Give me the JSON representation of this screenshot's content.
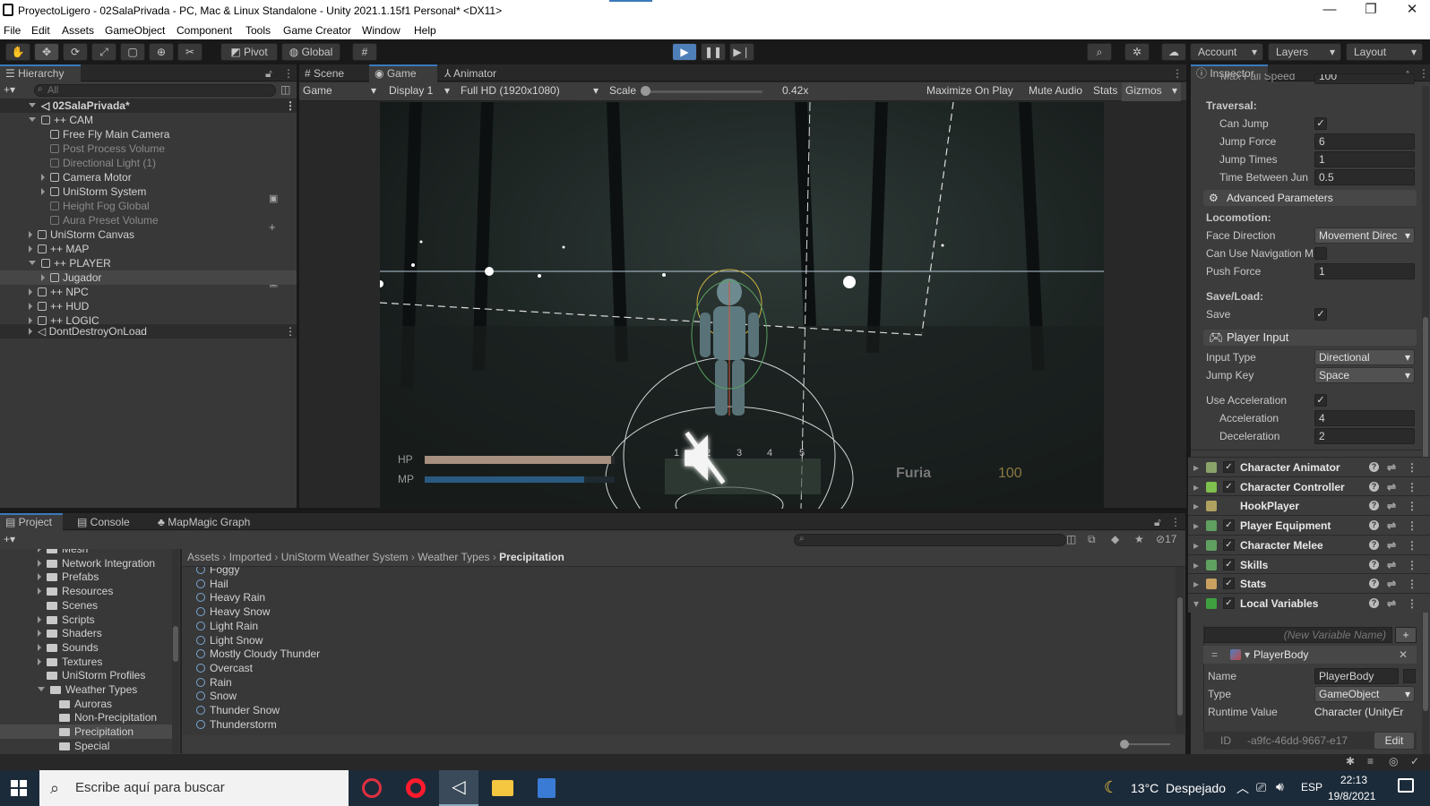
{
  "window": {
    "title": "ProyectoLigero - 02SalaPrivada - PC, Mac & Linux Standalone - Unity 2021.1.15f1 Personal* <DX11>",
    "controls": [
      "—",
      "❐",
      "✕"
    ]
  },
  "menu": [
    "File",
    "Edit",
    "Assets",
    "GameObject",
    "Component",
    "Tools",
    "Game Creator",
    "Window",
    "Help"
  ],
  "toolbar": {
    "pivot": "Pivot",
    "global": "Global",
    "account": "Account",
    "layers": "Layers",
    "layout": "Layout"
  },
  "hierarchy": {
    "tab": "Hierarchy",
    "search_placeholder": "All",
    "scene": "02SalaPrivada*",
    "items": [
      {
        "label": "++ CAM",
        "indent": 1,
        "exp": "down",
        "dim": false
      },
      {
        "label": "Free Fly Main Camera",
        "indent": 2,
        "exp": "",
        "dim": false
      },
      {
        "label": "Post Process Volume",
        "indent": 2,
        "exp": "",
        "dim": true
      },
      {
        "label": "Directional Light (1)",
        "indent": 2,
        "exp": "",
        "dim": true
      },
      {
        "label": "Camera Motor",
        "indent": 2,
        "exp": "right",
        "dim": false
      },
      {
        "label": "UniStorm System",
        "indent": 2,
        "exp": "right",
        "dim": false
      },
      {
        "label": "Height Fog Global",
        "indent": 2,
        "exp": "",
        "dim": true
      },
      {
        "label": "Aura Preset Volume",
        "indent": 2,
        "exp": "",
        "dim": true
      },
      {
        "label": "UniStorm Canvas",
        "indent": 1,
        "exp": "right",
        "dim": false
      },
      {
        "label": "++ MAP",
        "indent": 1,
        "exp": "right",
        "dim": false
      },
      {
        "label": "++ PLAYER",
        "indent": 1,
        "exp": "down",
        "dim": false
      },
      {
        "label": "Jugador",
        "indent": 2,
        "exp": "right",
        "dim": false,
        "selected": true
      },
      {
        "label": "++ NPC",
        "indent": 1,
        "exp": "right",
        "dim": false
      },
      {
        "label": "++ HUD",
        "indent": 1,
        "exp": "right",
        "dim": false
      },
      {
        "label": "++ LOGIC",
        "indent": 1,
        "exp": "right",
        "dim": false
      }
    ],
    "dontdestroy": "DontDestroyOnLoad"
  },
  "center_tabs": {
    "scene": "Scene",
    "game": "Game",
    "animator": "Animator"
  },
  "game_bar": {
    "mode": "Game",
    "display": "Display 1",
    "resolution": "Full HD (1920x1080)",
    "scale_label": "Scale",
    "scale_value": "0.42x",
    "maximize": "Maximize On Play",
    "mute": "Mute Audio",
    "stats": "Stats",
    "gizmos": "Gizmos"
  },
  "hud": {
    "hp": "HP",
    "mp": "MP",
    "hp_fill": 0.98,
    "mp_fill": 0.84,
    "slots": [
      "1",
      "2",
      "3",
      "4",
      "5"
    ],
    "furia_label": "Furia",
    "furia_value": "100"
  },
  "inspector": {
    "tab": "Inspector",
    "cut_label": "Max Fall Speed",
    "cut_value": "100",
    "traversal": "Traversal:",
    "can_jump": "Can Jump",
    "jump_force": "Jump Force",
    "jump_force_v": "6",
    "jump_times": "Jump Times",
    "jump_times_v": "1",
    "time_between": "Time Between Jun",
    "time_between_v": "0.5",
    "adv": "Advanced Parameters",
    "locomotion": "Locomotion:",
    "face_dir": "Face Direction",
    "face_dir_v": "Movement Direc",
    "can_nav": "Can Use Navigation M",
    "push": "Push Force",
    "push_v": "1",
    "saveload": "Save/Load:",
    "save": "Save",
    "player_input": "Player Input",
    "input_type": "Input Type",
    "input_type_v": "Directional",
    "jump_key": "Jump Key",
    "jump_key_v": "Space",
    "use_acc": "Use Acceleration",
    "acc": "Acceleration",
    "acc_v": "4",
    "dec": "Deceleration",
    "dec_v": "2",
    "components": [
      {
        "name": "Character Animator",
        "color": "#8aa36b",
        "check": true
      },
      {
        "name": "Character Controller",
        "color": "#7fbf4d",
        "check": true
      },
      {
        "name": "HookPlayer",
        "color": "#b0a060",
        "check": false
      },
      {
        "name": "Player Equipment",
        "color": "#5fa060",
        "check": true
      },
      {
        "name": "Character Melee",
        "color": "#5fa060",
        "check": true
      },
      {
        "name": "Skills",
        "color": "#5fa060",
        "check": true
      },
      {
        "name": "Stats",
        "color": "#c8a060",
        "check": true
      },
      {
        "name": "Local Variables",
        "color": "#3fa040",
        "check": true
      }
    ],
    "new_var": "(New Variable Name)",
    "var_name": "PlayerBody",
    "name_label": "Name",
    "name_v": "PlayerBody",
    "type_label": "Type",
    "type_v": "GameObject",
    "runtime_label": "Runtime Value",
    "runtime_v": "Character (UnityEr",
    "id_label": "ID",
    "id_v": "-a9fc-46dd-9667-e17",
    "edit": "Edit"
  },
  "bottom_tabs": {
    "project": "Project",
    "console": "Console",
    "mapmagic": "MapMagic Graph"
  },
  "hidden_count": "17",
  "project_tree": [
    {
      "label": "Mesh",
      "indent": 2,
      "exp": "right",
      "cut": true
    },
    {
      "label": "Network Integration",
      "indent": 2,
      "exp": "right"
    },
    {
      "label": "Prefabs",
      "indent": 2,
      "exp": "right"
    },
    {
      "label": "Resources",
      "indent": 2,
      "exp": "right"
    },
    {
      "label": "Scenes",
      "indent": 2,
      "exp": ""
    },
    {
      "label": "Scripts",
      "indent": 2,
      "exp": "right"
    },
    {
      "label": "Shaders",
      "indent": 2,
      "exp": "right"
    },
    {
      "label": "Sounds",
      "indent": 2,
      "exp": "right"
    },
    {
      "label": "Textures",
      "indent": 2,
      "exp": "right"
    },
    {
      "label": "UniStorm Profiles",
      "indent": 2,
      "exp": ""
    },
    {
      "label": "Weather Types",
      "indent": 2,
      "exp": "down"
    },
    {
      "label": "Auroras",
      "indent": 3,
      "exp": ""
    },
    {
      "label": "Non-Precipitation",
      "indent": 3,
      "exp": ""
    },
    {
      "label": "Precipitation",
      "indent": 3,
      "exp": "",
      "selected": true
    },
    {
      "label": "Special",
      "indent": 3,
      "exp": ""
    }
  ],
  "breadcrumb": [
    "Assets",
    "Imported",
    "UniStorm Weather System",
    "Weather Types",
    "Precipitation"
  ],
  "files": [
    "Foggy",
    "Hail",
    "Heavy Rain",
    "Heavy Snow",
    "Light Rain",
    "Light Snow",
    "Mostly Cloudy Thunder",
    "Overcast",
    "Rain",
    "Snow",
    "Thunder Snow",
    "Thunderstorm"
  ],
  "taskbar": {
    "search": "Escribe aquí para buscar",
    "weather": "13°C  Despejado",
    "lang": "ESP",
    "time": "22:13",
    "date": "19/8/2021"
  }
}
